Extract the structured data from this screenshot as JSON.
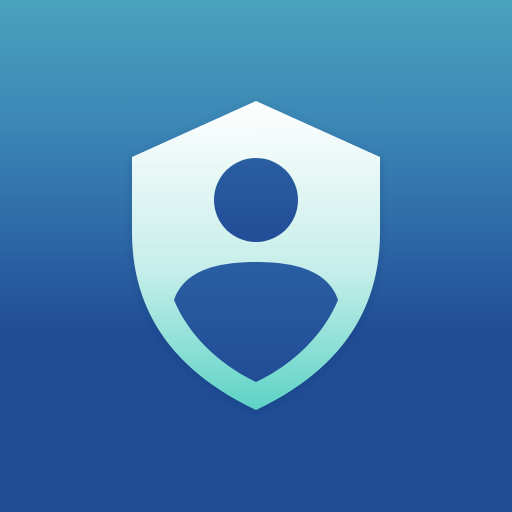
{
  "icon": {
    "name": "user-shield-icon",
    "colors": {
      "background_top": "#4aa2bd",
      "background_bottom": "#214d96",
      "shield_top": "#ffffff",
      "shield_bottom": "#5dd3c6"
    }
  }
}
